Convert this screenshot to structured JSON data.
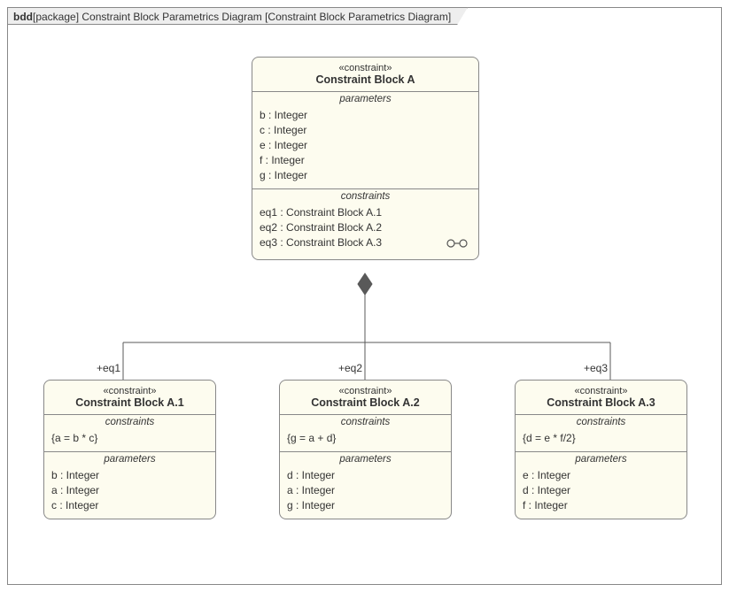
{
  "frame": {
    "kind": "bdd",
    "rest": "[package] Constraint Block Parametrics Diagram [Constraint Block Parametrics Diagram]"
  },
  "parent": {
    "stereotype": "«constraint»",
    "title": "Constraint Block A",
    "paramsHeader": "parameters",
    "params": [
      "b : Integer",
      "c : Integer",
      "e : Integer",
      "f : Integer",
      "g : Integer"
    ],
    "constraintsHeader": "constraints",
    "constraints": [
      "eq1 : Constraint Block A.1",
      "eq2 : Constraint Block A.2",
      "eq3 : Constraint Block A.3"
    ]
  },
  "roles": {
    "r1": "+eq1",
    "r2": "+eq2",
    "r3": "+eq3"
  },
  "child1": {
    "stereotype": "«constraint»",
    "title": "Constraint Block A.1",
    "constraintsHeader": "constraints",
    "constraints": [
      "{a = b * c}"
    ],
    "paramsHeader": "parameters",
    "params": [
      "b : Integer",
      "a : Integer",
      "c : Integer"
    ]
  },
  "child2": {
    "stereotype": "«constraint»",
    "title": "Constraint Block A.2",
    "constraintsHeader": "constraints",
    "constraints": [
      "{g = a + d}"
    ],
    "paramsHeader": "parameters",
    "params": [
      "d : Integer",
      "a : Integer",
      "g : Integer"
    ]
  },
  "child3": {
    "stereotype": "«constraint»",
    "title": "Constraint Block A.3",
    "constraintsHeader": "constraints",
    "constraints": [
      "{d = e *  f/2}"
    ],
    "paramsHeader": "parameters",
    "params": [
      "e : Integer",
      "d : Integer",
      "f : Integer"
    ]
  }
}
